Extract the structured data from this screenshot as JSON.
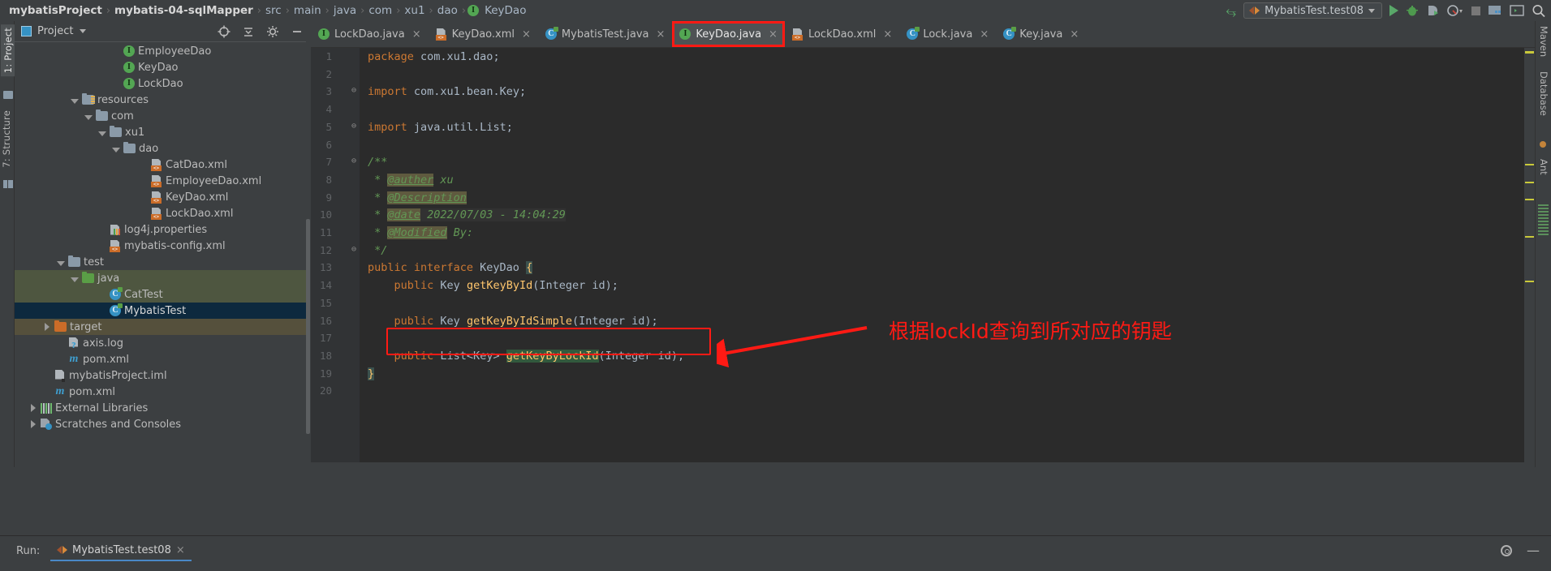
{
  "breadcrumb": {
    "items": [
      {
        "label": "mybatisProject",
        "bold": true
      },
      {
        "label": "mybatis-04-sqlMapper",
        "bold": true
      },
      {
        "label": "src",
        "bold": false
      },
      {
        "label": "main",
        "bold": false
      },
      {
        "label": "java",
        "bold": false
      },
      {
        "label": "com",
        "bold": false
      },
      {
        "label": "xu1",
        "bold": false
      },
      {
        "label": "dao",
        "bold": false
      },
      {
        "label": "KeyDao",
        "bold": false,
        "icon": "interface-icon"
      }
    ],
    "separator": "›"
  },
  "toolbar": {
    "build_icon": "hammer-icon",
    "run_config": "MybatisTest.test08",
    "run_config_dropdown": "▾",
    "buttons": [
      {
        "name": "run-button",
        "icon": "play-icon"
      },
      {
        "name": "debug-button",
        "icon": "bug-icon"
      },
      {
        "name": "run-with-coverage-button",
        "icon": "coverage-icon"
      },
      {
        "name": "profiler-button",
        "icon": "profiler-icon"
      },
      {
        "name": "stop-button",
        "icon": "stop-icon"
      },
      {
        "name": "project-structure-button",
        "icon": "project-structure-icon"
      },
      {
        "name": "terminal-button",
        "icon": "terminal-icon"
      },
      {
        "name": "search-everywhere-button",
        "icon": "search-icon"
      }
    ]
  },
  "left_strip": {
    "tabs": [
      "1: Project",
      "7: Structure"
    ],
    "active": "1: Project"
  },
  "right_strip": {
    "tabs": [
      "Maven",
      "Database",
      "Ant"
    ]
  },
  "project_panel": {
    "title": "Project",
    "dropdown": "▾",
    "actions": [
      "locate-icon",
      "collapse-all-icon",
      "settings-icon",
      "hide-icon"
    ],
    "tree": [
      {
        "label": "EmployeeDao",
        "indent": 7,
        "icon": "interface-icon",
        "arrow": "none",
        "state": "none"
      },
      {
        "label": "KeyDao",
        "indent": 7,
        "icon": "interface-icon",
        "arrow": "none",
        "state": "none"
      },
      {
        "label": "LockDao",
        "indent": 7,
        "icon": "interface-icon",
        "arrow": "none",
        "state": "none"
      },
      {
        "label": "resources",
        "indent": 4,
        "icon": "resources-folder-icon",
        "arrow": "down",
        "state": "none"
      },
      {
        "label": "com",
        "indent": 5,
        "icon": "folder-icon",
        "arrow": "down",
        "state": "none"
      },
      {
        "label": "xu1",
        "indent": 6,
        "icon": "folder-icon",
        "arrow": "down",
        "state": "none"
      },
      {
        "label": "dao",
        "indent": 7,
        "icon": "folder-icon",
        "arrow": "down",
        "state": "none"
      },
      {
        "label": "CatDao.xml",
        "indent": 9,
        "icon": "xml-file-icon",
        "arrow": "none",
        "state": "none"
      },
      {
        "label": "EmployeeDao.xml",
        "indent": 9,
        "icon": "xml-file-icon",
        "arrow": "none",
        "state": "none"
      },
      {
        "label": "KeyDao.xml",
        "indent": 9,
        "icon": "xml-file-icon",
        "arrow": "none",
        "state": "none"
      },
      {
        "label": "LockDao.xml",
        "indent": 9,
        "icon": "xml-file-icon",
        "arrow": "none",
        "state": "none"
      },
      {
        "label": "log4j.properties",
        "indent": 6,
        "icon": "properties-file-icon",
        "arrow": "none",
        "state": "none"
      },
      {
        "label": "mybatis-config.xml",
        "indent": 6,
        "icon": "xml-file-icon",
        "arrow": "none",
        "state": "none"
      },
      {
        "label": "test",
        "indent": 3,
        "icon": "folder-icon",
        "arrow": "down",
        "state": "none"
      },
      {
        "label": "java",
        "indent": 4,
        "icon": "source-folder-icon",
        "arrow": "down",
        "state": "selected-green"
      },
      {
        "label": "CatTest",
        "indent": 6,
        "icon": "class-test-icon",
        "arrow": "none",
        "state": "selected-green"
      },
      {
        "label": "MybatisTest",
        "indent": 6,
        "icon": "class-test-icon",
        "arrow": "none",
        "state": "selected-blue"
      },
      {
        "label": "target",
        "indent": 2,
        "icon": "excluded-folder-icon",
        "arrow": "right",
        "state": "selected-brown"
      },
      {
        "label": "axis.log",
        "indent": 3,
        "icon": "log-file-icon",
        "arrow": "none",
        "state": "none"
      },
      {
        "label": "pom.xml",
        "indent": 3,
        "icon": "maven-file-icon",
        "arrow": "none",
        "state": "none"
      },
      {
        "label": "mybatisProject.iml",
        "indent": 2,
        "icon": "module-file-icon",
        "arrow": "none",
        "state": "none"
      },
      {
        "label": "pom.xml",
        "indent": 2,
        "icon": "maven-file-icon",
        "arrow": "none",
        "state": "none"
      },
      {
        "label": "External Libraries",
        "indent": 1,
        "icon": "libraries-icon",
        "arrow": "right",
        "state": "none"
      },
      {
        "label": "Scratches and Consoles",
        "indent": 1,
        "icon": "scratches-icon",
        "arrow": "right",
        "state": "none"
      }
    ]
  },
  "editor_tabs": [
    {
      "label": "LockDao.java",
      "icon": "interface-icon",
      "active": false,
      "highlighted": false
    },
    {
      "label": "KeyDao.xml",
      "icon": "xml-file-icon",
      "active": false,
      "highlighted": false
    },
    {
      "label": "MybatisTest.java",
      "icon": "class-test-icon",
      "active": false,
      "highlighted": false
    },
    {
      "label": "KeyDao.java",
      "icon": "interface-icon",
      "active": true,
      "highlighted": true
    },
    {
      "label": "LockDao.xml",
      "icon": "xml-file-icon",
      "active": false,
      "highlighted": false
    },
    {
      "label": "Lock.java",
      "icon": "class-icon",
      "active": false,
      "highlighted": false
    },
    {
      "label": "Key.java",
      "icon": "class-icon",
      "active": false,
      "highlighted": false
    }
  ],
  "editor": {
    "close_glyph": "×",
    "lines": [
      {
        "n": 1,
        "fold": "",
        "text": "package com.xu1.dao;"
      },
      {
        "n": 2,
        "fold": "",
        "text": ""
      },
      {
        "n": 3,
        "fold": "-",
        "text": "import com.xu1.bean.Key;"
      },
      {
        "n": 4,
        "fold": "",
        "text": ""
      },
      {
        "n": 5,
        "fold": "-",
        "text": "import java.util.List;"
      },
      {
        "n": 6,
        "fold": "",
        "text": ""
      },
      {
        "n": 7,
        "fold": "-",
        "text": "/**"
      },
      {
        "n": 8,
        "fold": "",
        "text": " * @auther xu"
      },
      {
        "n": 9,
        "fold": "",
        "text": " * @Description"
      },
      {
        "n": 10,
        "fold": "",
        "text": " * @date 2022/07/03 - 14:04:29"
      },
      {
        "n": 11,
        "fold": "",
        "text": " * @Modified By:"
      },
      {
        "n": 12,
        "fold": "-",
        "text": " */"
      },
      {
        "n": 13,
        "fold": "",
        "text": "public interface KeyDao {"
      },
      {
        "n": 14,
        "fold": "",
        "text": "    public Key getKeyById(Integer id);"
      },
      {
        "n": 15,
        "fold": "",
        "text": ""
      },
      {
        "n": 16,
        "fold": "",
        "text": "    public Key getKeyByIdSimple(Integer id);"
      },
      {
        "n": 17,
        "fold": "",
        "text": ""
      },
      {
        "n": 18,
        "fold": "",
        "text": "    public List<Key> getKeyByLockId(Integer id);"
      },
      {
        "n": 19,
        "fold": "",
        "text": "}"
      },
      {
        "n": 20,
        "fold": "",
        "text": ""
      }
    ],
    "javadoc_tags": [
      "@auther",
      "@Description",
      "@date",
      "@Modified"
    ],
    "javadoc_date": "2022/07/03 - 14:04:29",
    "javadoc_author": "xu",
    "javadoc_modified_by": "By:"
  },
  "annotation": {
    "note_text": "根据lockId查询到所对应的钥匙",
    "color": "#ff1a14"
  },
  "run_panel": {
    "label": "Run:",
    "tab": "MybatisTest.test08",
    "tab_icon": "run-config-icon",
    "close_glyph": "×",
    "settings_icon": "gear-icon",
    "minimize_icon": "minimize-icon"
  },
  "colors": {
    "accent_red": "#ff1a14",
    "editor_bg": "#2b2b2b",
    "panel_bg": "#3c3f41",
    "selection_blue": "#0d293e",
    "selection_green": "#4e5640",
    "selection_brown": "#55503c",
    "keyword_orange": "#cc7832",
    "comment_green": "#629755",
    "method_yellow": "#ffc66d"
  }
}
